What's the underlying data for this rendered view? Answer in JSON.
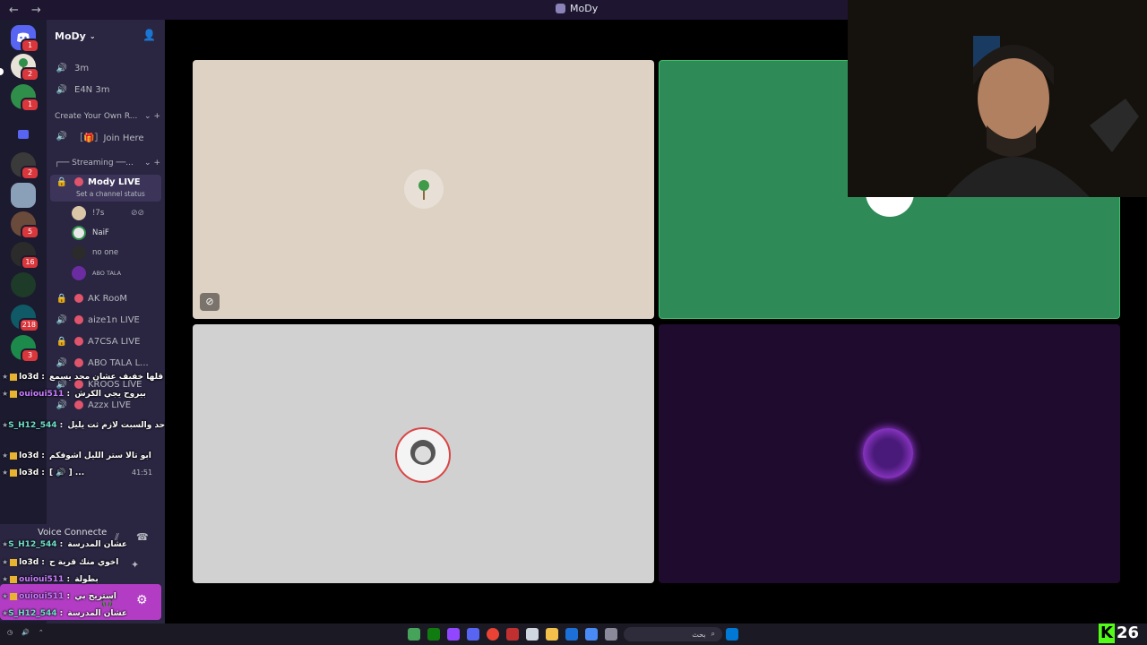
{
  "window": {
    "title": "MoDy"
  },
  "server": {
    "name": "MoDy"
  },
  "guilds": [
    {
      "badge": "1"
    },
    {
      "badge": "2"
    },
    {
      "badge": "1"
    },
    {
      "badge": ""
    },
    {
      "badge": "2"
    },
    {
      "badge": ""
    },
    {
      "badge": "5"
    },
    {
      "badge": "16"
    },
    {
      "badge": ""
    },
    {
      "badge": "218"
    },
    {
      "badge": "3"
    }
  ],
  "channels": {
    "top": [
      {
        "name": "3m"
      },
      {
        "name": "E4N 3m"
      }
    ],
    "category1": "Create Your Own R...",
    "join_here": "［🎁］Join Here",
    "category2": "┌── Streaming ──...",
    "active": {
      "name": "Mody LIVE",
      "status": "Set a channel status"
    },
    "members": [
      {
        "name": "!7s"
      },
      {
        "name": "NaiF"
      },
      {
        "name": "no one"
      },
      {
        "name": "ABO TALA"
      }
    ],
    "rooms": [
      {
        "name": "AK RooM",
        "locked": true
      },
      {
        "name": "aize1n LIVE",
        "locked": false
      },
      {
        "name": "A7CSA LIVE",
        "locked": true
      },
      {
        "name": "ABO TALA L...",
        "locked": false
      },
      {
        "name": "KROOS LIVE",
        "locked": false
      },
      {
        "name": "Azzx LIVE",
        "locked": false
      }
    ],
    "timer": "41:51"
  },
  "chat": [
    {
      "user": "lo3d",
      "text": "قلها خفيف عشان محد يسمع",
      "color": "#ffffff"
    },
    {
      "user": "ouioui511",
      "text": "بيروح يجي الكرش",
      "color": "#c77dff"
    },
    {
      "user": "S_H12_544",
      "text": "ابو تالا الاحد والسبت لازم ثت يليل",
      "color": "#6ee0c8"
    },
    {
      "user": "lo3d",
      "text": "ابو تالا ستر الليل اشوفكم",
      "color": "#ffffff"
    },
    {
      "user": "lo3d",
      "text": "[ 🔊 ] ...",
      "color": "#ffffff"
    },
    {
      "user": "S_H12_544",
      "text": "عشان المدرسة",
      "color": "#6ee0c8"
    },
    {
      "user": "lo3d",
      "text": "اخوي منك قرية ح",
      "color": "#ffffff"
    },
    {
      "user": "ouioui511",
      "text": "بطولة",
      "color": "#c77dff"
    },
    {
      "user": "ouioui511",
      "text": "استريح بي",
      "color": "#c77dff"
    },
    {
      "user": "S_H12_544",
      "text": "عشان المدرسة",
      "color": "#6ee0c8"
    }
  ],
  "voice": {
    "status": "Voice Connecte"
  },
  "taskbar": {
    "search_placeholder": "بحث",
    "overlay_number": "26",
    "overlay_letter": "K"
  },
  "colors": {
    "tile_beige": "#ded2c4",
    "tile_green": "#2e8b57",
    "tile_grey": "#d1d1d1",
    "tile_purple": "#1f0b2e",
    "accent_live": "#e0556c"
  }
}
